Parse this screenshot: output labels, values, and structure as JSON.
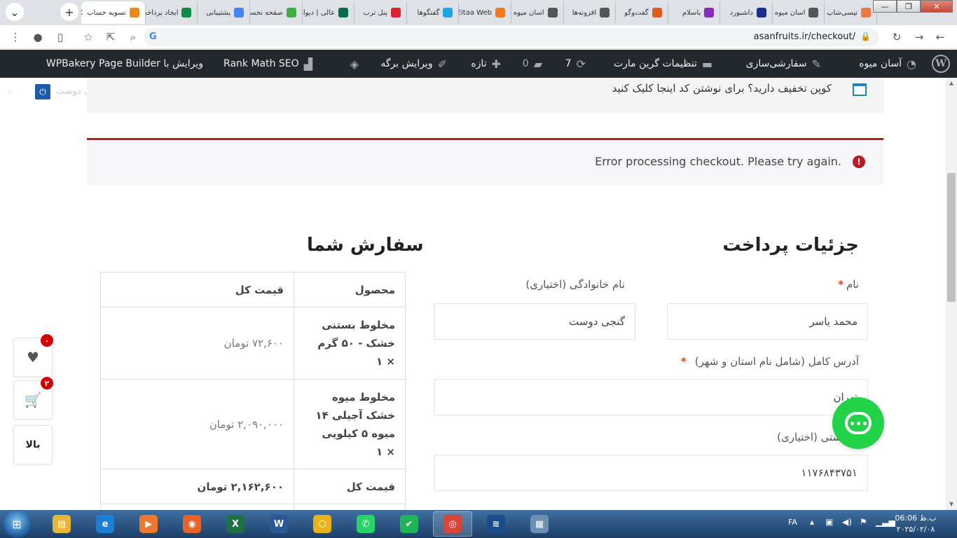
{
  "browser": {
    "tabs": [
      {
        "label": "تیسی‌شاپ",
        "color": "#f0783c"
      },
      {
        "label": "اسان میوه",
        "color": "#555555"
      },
      {
        "label": "داشبورد",
        "color": "#1d2f8a"
      },
      {
        "label": "باسلام",
        "color": "#8a2bbf"
      },
      {
        "label": "گفت‌وگو",
        "color": "#e05a1c"
      },
      {
        "label": "افزونه‌ها",
        "color": "#555555"
      },
      {
        "label": "اسان میوه",
        "color": "#555555"
      },
      {
        "label": "Eitaa Web",
        "color": "#f07b1d"
      },
      {
        "label": "گفتگوها",
        "color": "#1ea7e8"
      },
      {
        "label": "پنل ترب",
        "color": "#e0202f"
      },
      {
        "label": "عالی | دیوار",
        "color": "#0a6b4a"
      },
      {
        "label": "صفحه نخست",
        "color": "#3fae49"
      },
      {
        "label": "پشتیبانی",
        "color": "#4285f4"
      },
      {
        "label": "ایجاد پرداخت",
        "color": "#0f8a47"
      },
      {
        "label": "تسویه حساب",
        "color": "#e8891c",
        "active": true
      }
    ],
    "new_tab": "+",
    "tab_search": "⌄",
    "window": {
      "minimize": "—",
      "restore": "❐",
      "close": "✕"
    },
    "url": "asanfruits.ir/checkout/"
  },
  "adminbar": {
    "site_name": "آسان میوه",
    "customize": "سفارشی‌سازی",
    "theme_settings": "تنظیمات گرین مارت",
    "updates_count": "7",
    "comments_count": "0",
    "new_label": "تازه",
    "edit_page": "ویرایش برگه",
    "rank_math": "Rank Math SEO",
    "wpbakery": "ویرایش با WPBakery Page Builder"
  },
  "notice": {
    "coupon": "کوپن تخفیف دارید؟ برای نوشتن کد اینجا کلیک کنید",
    "greeting": "سلام محمد یاسر گنجی دوست"
  },
  "error": {
    "message": "Error processing checkout. Please try again."
  },
  "billing": {
    "heading": "جزئیات پرداخت",
    "first_name": {
      "label": "نام",
      "required": "*",
      "value": "محمد یاسر"
    },
    "last_name": {
      "label": "نام خانوادگی (اختیاری)",
      "value": "گنجی دوست"
    },
    "address": {
      "label": "آدرس کامل (شامل نام استان و شهر)",
      "required": "*",
      "value": "تهران"
    },
    "postcode": {
      "label": "کد پستی (اختیاری)",
      "value": "۱۱۷۶۸۴۳۷۵۱"
    }
  },
  "order": {
    "heading": "سفارش شما",
    "col_product": "محصول",
    "col_total": "قیمت کل",
    "items": [
      {
        "name": "مخلوط بستنی خشک - ۵۰ گرم",
        "qty": "× ۱",
        "total": "۷۲,۶۰۰ تومان"
      },
      {
        "name": "مخلوط میوه خشک آجیلی ۱۴ میوه ۵ کیلویی",
        "qty": "× ۱",
        "total": "۲,۰۹۰,۰۰۰ تومان"
      }
    ],
    "total_label": "قیمت کل",
    "total_value": "۲,۱۶۲,۶۰۰ تومان"
  },
  "widgets": {
    "wishlist_count": "۰",
    "cart_count": "۲",
    "to_top": "بالا"
  },
  "taskbar": {
    "lang": "FA",
    "time": "06:06 ب.ظ",
    "date": "۲۰۲۵/۰۲/۰۸",
    "apps": [
      {
        "name": "file-explorer",
        "glyph": "▤",
        "color": "#e7b53a"
      },
      {
        "name": "internet-explorer",
        "glyph": "e",
        "color": "#1c7fd6"
      },
      {
        "name": "media-player",
        "glyph": "▶",
        "color": "#f0782e"
      },
      {
        "name": "firefox",
        "glyph": "◉",
        "color": "#e8622a"
      },
      {
        "name": "excel",
        "glyph": "X",
        "color": "#1e7145"
      },
      {
        "name": "word",
        "glyph": "W",
        "color": "#2b5797"
      },
      {
        "name": "app-hexagon",
        "glyph": "⬡",
        "color": "#e8b31c"
      },
      {
        "name": "whatsapp",
        "glyph": "✆",
        "color": "#25d366"
      },
      {
        "name": "checkmark-app",
        "glyph": "✔",
        "color": "#1fb35a"
      },
      {
        "name": "chrome",
        "glyph": "◎",
        "color": "#db4437"
      },
      {
        "name": "accounting-app",
        "glyph": "≋",
        "color": "#1a4c8c"
      },
      {
        "name": "control-panel",
        "glyph": "▦",
        "color": "#6d8fb3"
      }
    ]
  }
}
